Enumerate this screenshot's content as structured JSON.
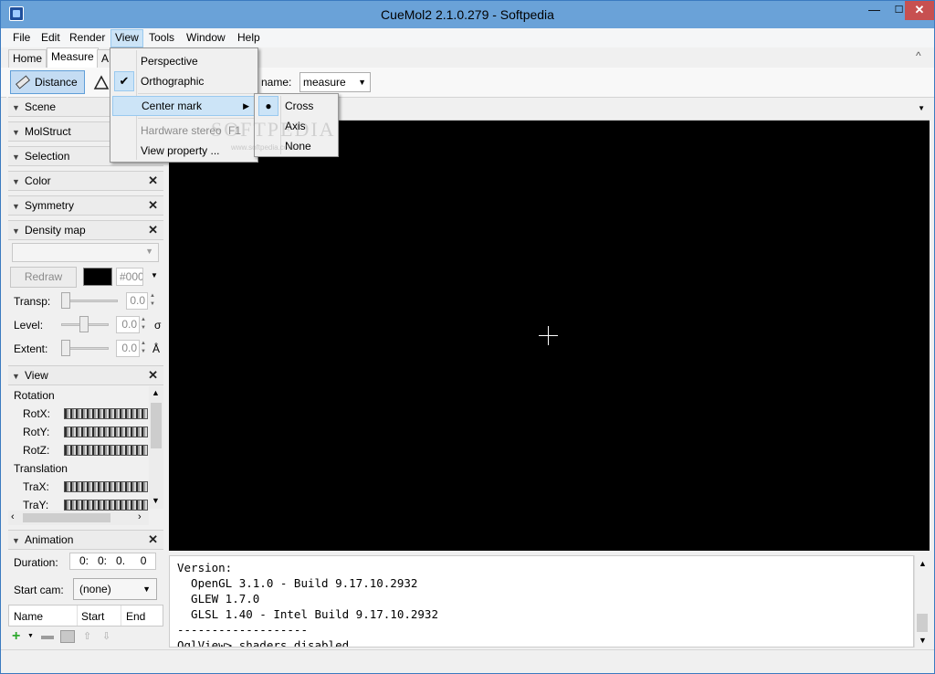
{
  "window": {
    "title": "CueMol2 2.1.0.279 - Softpedia",
    "min_glyph": "—",
    "max_glyph": "☐",
    "close_glyph": "✕"
  },
  "menubar": [
    "File",
    "Edit",
    "Render",
    "View",
    "Tools",
    "Window",
    "Help"
  ],
  "ribbon": {
    "tabs": [
      "Home",
      "Measure",
      "A"
    ],
    "distance_label": "Distance",
    "name_label": "name:",
    "name_value": "measure",
    "collapse_glyph": "^"
  },
  "panels": {
    "scene": "Scene",
    "molstruct": "MolStruct",
    "selection": "Selection",
    "color": "Color",
    "symmetry": "Symmetry",
    "density_map": "Density map",
    "view": "View",
    "animation": "Animation"
  },
  "density": {
    "redraw": "Redraw",
    "color_code": "#000",
    "transp_label": "Transp:",
    "transp_value": "0.0",
    "level_label": "Level:",
    "level_value": "0.0",
    "level_unit": "σ",
    "extent_label": "Extent:",
    "extent_value": "0.0",
    "extent_unit": "Å"
  },
  "view_panel": {
    "rotation": "Rotation",
    "rotx": "RotX:",
    "roty": "RotY:",
    "rotz": "RotZ:",
    "translation": "Translation",
    "trax": "TraX:",
    "tray": "TraY:"
  },
  "animation": {
    "duration_label": "Duration:",
    "duration_value": "0:   0:   0.     0",
    "startcam_label": "Start cam:",
    "startcam_value": "(none)",
    "columns": [
      "Name",
      "Start",
      "End"
    ]
  },
  "view_menu": {
    "perspective": "Perspective",
    "orthographic": "Orthographic",
    "center_mark": "Center mark",
    "hardware_stereo": "Hardware stereo",
    "hardware_stereo_key": "F1",
    "view_property": "View property ..."
  },
  "center_mark_menu": [
    "Cross",
    "Axis",
    "None"
  ],
  "watermark": "SOFTPEDIA",
  "watermark_url": "www.softpedia.com",
  "console": {
    "lines": [
      "Version:",
      "  OpenGL 3.1.0 - Build 9.17.10.2932",
      "  GLEW 1.7.0",
      "  GLSL 1.40 - Intel Build 9.17.10.2932",
      "-------------------",
      "OglView> shaders disabled"
    ]
  },
  "colors": {
    "title_bar": "#6aa2d8",
    "highlight": "#cce4f7",
    "viewport_bg": "#000000",
    "close_btn": "#c75050"
  }
}
